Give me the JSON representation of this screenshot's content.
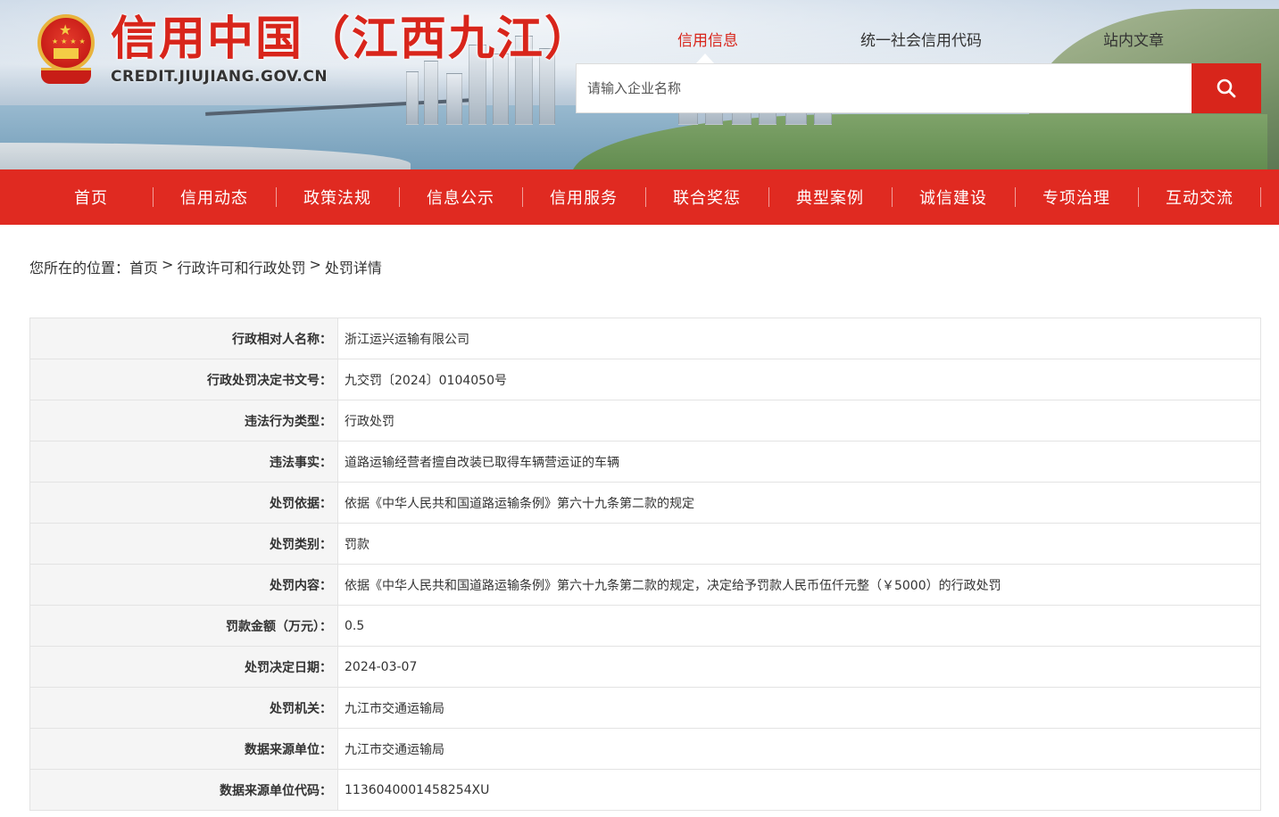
{
  "header": {
    "site_title": "信用中国（江西九江）",
    "site_url": "CREDIT.JIUJIANG.GOV.CN",
    "search_tabs": [
      "信用信息",
      "统一社会信用代码",
      "站内文章"
    ],
    "active_tab": "信用信息",
    "search_placeholder": "请输入企业名称",
    "accent_color": "#d8251b",
    "search_icon": "search-icon",
    "emblem_icon": "national-emblem-icon"
  },
  "nav": {
    "items": [
      "首页",
      "信用动态",
      "政策法规",
      "信息公示",
      "信用服务",
      "联合奖惩",
      "典型案例",
      "诚信建设",
      "专项治理",
      "互动交流"
    ],
    "background": "#e02a21"
  },
  "breadcrumb": {
    "prefix": "您所在的位置：",
    "items": [
      "首页",
      "行政许可和行政处罚",
      "处罚详情"
    ],
    "separator": ">"
  },
  "detail": {
    "rows": [
      {
        "label": "行政相对人名称：",
        "value": "浙江运兴运输有限公司"
      },
      {
        "label": "行政处罚决定书文号：",
        "value": "九交罚〔2024〕0104050号"
      },
      {
        "label": "违法行为类型：",
        "value": "行政处罚"
      },
      {
        "label": "违法事实：",
        "value": "道路运输经营者擅自改装已取得车辆营运证的车辆"
      },
      {
        "label": "处罚依据：",
        "value": "依据《中华人民共和国道路运输条例》第六十九条第二款的规定"
      },
      {
        "label": "处罚类别：",
        "value": "罚款"
      },
      {
        "label": "处罚内容：",
        "value": "依据《中华人民共和国道路运输条例》第六十九条第二款的规定，决定给予罚款人民币伍仟元整（￥5000）的行政处罚"
      },
      {
        "label": "罚款金额（万元）：",
        "value": "0.5"
      },
      {
        "label": "处罚决定日期：",
        "value": "2024-03-07"
      },
      {
        "label": "处罚机关：",
        "value": "九江市交通运输局"
      },
      {
        "label": "数据来源单位：",
        "value": "九江市交通运输局"
      },
      {
        "label": "数据来源单位代码：",
        "value": "11360400014582​54XU"
      }
    ]
  }
}
